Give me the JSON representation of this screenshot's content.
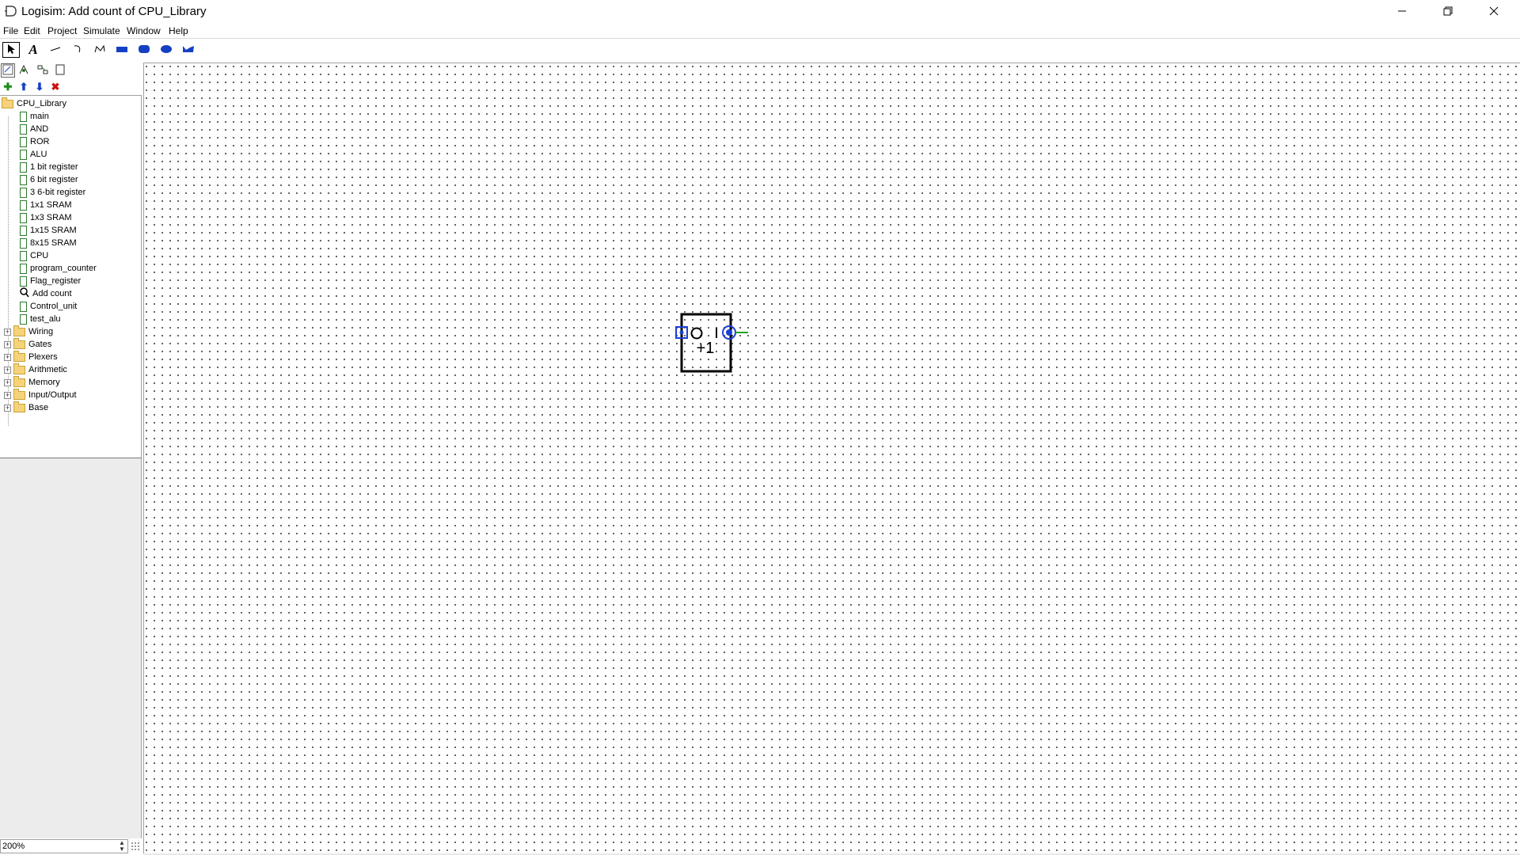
{
  "window": {
    "title": "Logisim: Add count of CPU_Library",
    "controls": [
      "minimize-icon",
      "restore-icon",
      "close-icon"
    ]
  },
  "menu": [
    "File",
    "Edit",
    "Project",
    "Simulate",
    "Window",
    "Help"
  ],
  "toolbar": {
    "tools": [
      "select-tool",
      "text-tool",
      "line-tool",
      "curve-tool",
      "polyline-tool",
      "rectangle-tool",
      "rounded-rectangle-tool",
      "oval-tool",
      "polygon-tool"
    ]
  },
  "explorer": {
    "project_name": "CPU_Library",
    "circuits": [
      "main",
      "AND",
      "ROR",
      "ALU",
      "1 bit register",
      "6 bit register",
      "3 6-bit register",
      "1x1 SRAM",
      "1x3 SRAM",
      "1x15 SRAM",
      "8x15 SRAM",
      "CPU",
      "program_counter",
      "Flag_register",
      "Add count",
      "Control_unit",
      "test_alu"
    ],
    "current_circuit": "Add count",
    "libraries": [
      "Wiring",
      "Gates",
      "Plexers",
      "Arithmetic",
      "Memory",
      "Input/Output",
      "Base"
    ]
  },
  "zoom": "200%",
  "component": {
    "label": "+1",
    "accent_blue": "#1a3fd6",
    "wire_green": "#21a321"
  }
}
